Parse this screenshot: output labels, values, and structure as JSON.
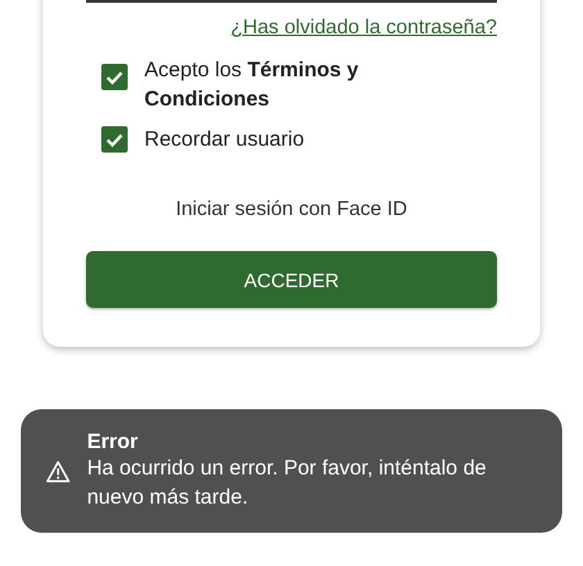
{
  "login_card": {
    "forgot_password_link": "¿Has olvidado la contraseña?",
    "checkboxes": [
      {
        "label": "Acepto los **Términos y Condiciones**",
        "checked": true
      },
      {
        "label": "Recordar usuario",
        "checked": true
      }
    ],
    "face_id_link": "Iniciar sesión con Face ID",
    "submit_button": "ACCEDER"
  },
  "toast": {
    "title": "Error",
    "message": "Ha ocurrido un error. Por favor, inténtalo de nuevo más tarde."
  }
}
